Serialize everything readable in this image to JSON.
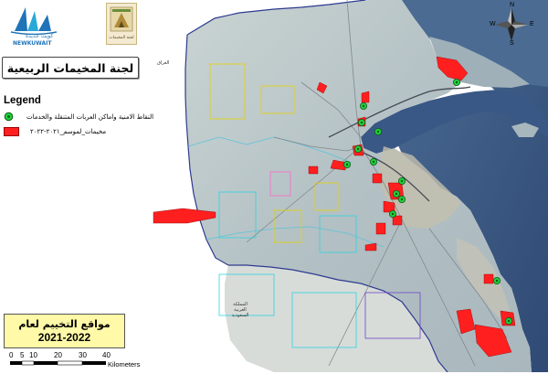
{
  "header": {
    "committee_title": "لجنة المخيمات الربيعية"
  },
  "logos": {
    "left_logo_word": "NEWKUWAIT",
    "left_logo_arabic": "كويت جديدة",
    "right_logo_caption": "لجنة المخيمات"
  },
  "legend": {
    "title": "Legend",
    "items": [
      {
        "label": "النقاط الامنية واماكن العربات المتنقلة والخدمات",
        "symbol": "green-dot"
      },
      {
        "label": "مخيمات_لموسم_٢٠٢١-٢٠٢٢",
        "symbol": "red-rect"
      }
    ]
  },
  "camping_box": {
    "line1": "مواقع التخييم لعام",
    "line2": "2021-2022"
  },
  "scale_bar": {
    "ticks": [
      "0",
      "5",
      "10",
      "20",
      "30",
      "40"
    ],
    "unit": "Kilometers"
  },
  "compass": {
    "n": "N",
    "s": "S",
    "e": "E",
    "w": "W"
  },
  "map_labels": {
    "iraq": "العراق",
    "saudi": "المملكة العربية السعودية"
  },
  "colors": {
    "sea": "#3b5a86",
    "land": "#b9c6c8",
    "camp_red": "#ff1f1f",
    "point_green": "#22d13a",
    "boundary": "#2e3b8f"
  }
}
